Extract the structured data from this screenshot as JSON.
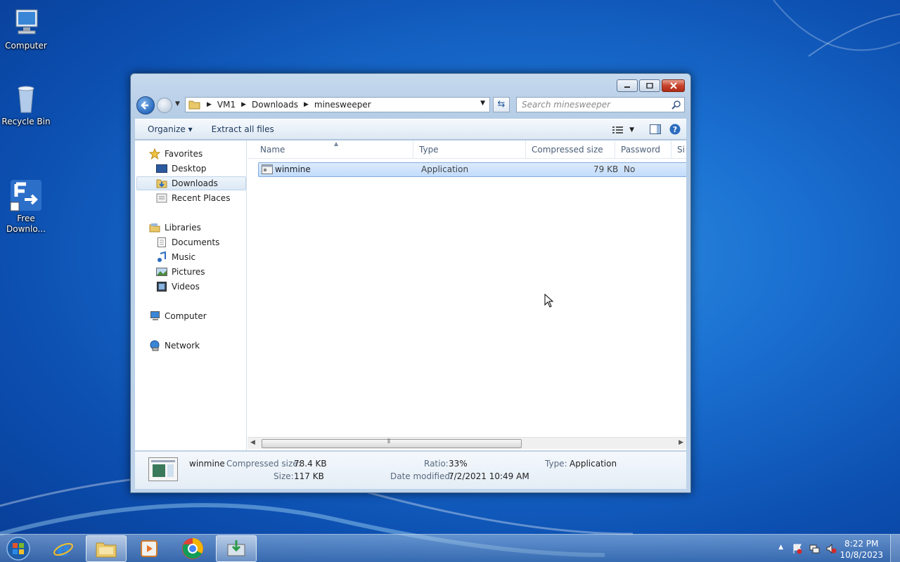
{
  "desktop": {
    "icons": [
      {
        "label": "Computer",
        "icon": "computer-icon"
      },
      {
        "label": "Recycle Bin",
        "icon": "recycle-bin-icon"
      },
      {
        "label": "Free\nDownlo...",
        "icon": "free-download-manager-icon"
      }
    ]
  },
  "explorer": {
    "address": {
      "crumbs": [
        "VM1",
        "Downloads",
        "minesweeper"
      ]
    },
    "search": {
      "placeholder": "Search minesweeper"
    },
    "toolbar": {
      "organize": "Organize",
      "extract_all": "Extract all files"
    },
    "nav": {
      "favorites": "Favorites",
      "desktop": "Desktop",
      "downloads": "Downloads",
      "recent_places": "Recent Places",
      "libraries": "Libraries",
      "documents": "Documents",
      "music": "Music",
      "pictures": "Pictures",
      "videos": "Videos",
      "computer": "Computer",
      "network": "Network"
    },
    "columns": [
      "Name",
      "Type",
      "Compressed size",
      "Password ...",
      "Si"
    ],
    "files": [
      {
        "name": "winmine",
        "type": "Application",
        "compressed_size": "79 KB",
        "password": "No"
      }
    ],
    "details": {
      "name": "winmine",
      "compressed_size_label": "Compressed size:",
      "compressed_size": "78.4 KB",
      "size_label": "Size:",
      "size": "117 KB",
      "ratio_label": "Ratio:",
      "ratio": "33%",
      "date_modified_label": "Date modified:",
      "date_modified": "7/2/2021 10:49 AM",
      "type_label": "Type:",
      "type": "Application"
    }
  },
  "taskbar": {
    "apps": [
      "internet-explorer-icon",
      "windows-explorer-icon",
      "media-player-icon",
      "chrome-icon",
      "free-download-manager-icon"
    ],
    "clock": {
      "time": "8:22 PM",
      "date": "10/8/2023"
    }
  }
}
